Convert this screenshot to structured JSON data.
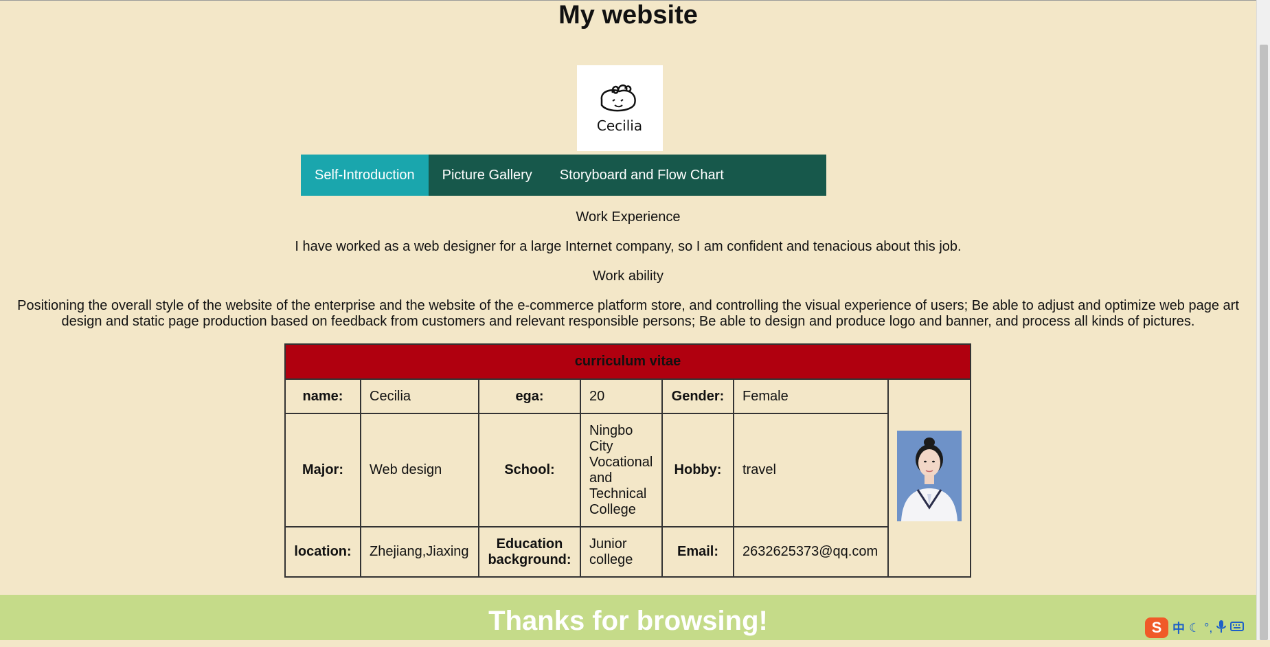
{
  "page": {
    "title": "My website",
    "logo_text": "Cecilia",
    "footer": "Thanks for browsing!"
  },
  "nav": {
    "items": [
      {
        "label": "Self-Introduction",
        "active": true
      },
      {
        "label": "Picture Gallery",
        "active": false
      },
      {
        "label": "Storyboard and Flow Chart",
        "active": false
      }
    ]
  },
  "intro": {
    "work_experience_heading": "Work Experience",
    "work_experience_text": "I have worked as a web designer for a large Internet company, so I am confident and tenacious about this job.",
    "work_ability_heading": "Work ability",
    "work_ability_text": "Positioning the overall style of the website of the enterprise and the website of the e-commerce platform store, and controlling the visual experience of users; Be able to adjust and optimize web page art design and static page production based on feedback from customers and relevant responsible persons; Be able to design and produce logo and banner, and process all kinds of pictures."
  },
  "cv": {
    "title": "curriculum vitae",
    "name_label": "name:",
    "name_value": "Cecilia",
    "age_label": "ega:",
    "age_value": "20",
    "gender_label": "Gender:",
    "gender_value": "Female",
    "major_label": "Major:",
    "major_value": "Web design",
    "school_label": "School:",
    "school_value": "Ningbo City Vocational and Technical College",
    "hobby_label": "Hobby:",
    "hobby_value": "travel",
    "location_label": "location:",
    "location_value": "Zhejiang,Jiaxing",
    "education_label": "Education background:",
    "education_value": "Junior college",
    "email_label": "Email:",
    "email_value": "2632625373@qq.com"
  },
  "ime": {
    "logo": "S",
    "mode": "中"
  },
  "colors": {
    "background": "#f3e7c8",
    "nav": "#17584b",
    "nav_active": "#1aa6ad",
    "cv_header": "#b0000f",
    "footer": "#c5db89"
  }
}
